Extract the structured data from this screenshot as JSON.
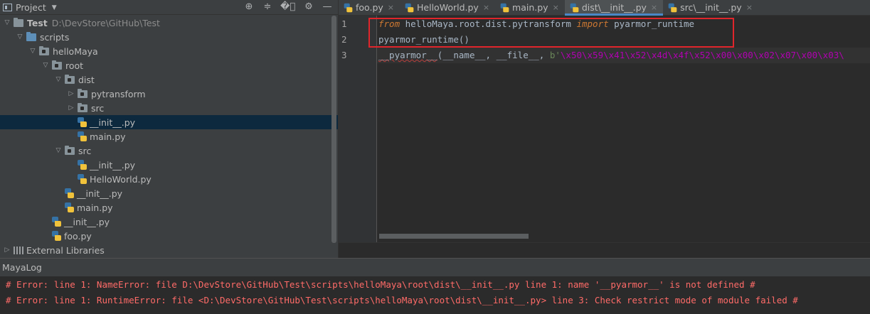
{
  "project_panel": {
    "title": "Project",
    "toolbar_icons": [
      "locate-icon",
      "expand-all-icon",
      "collapse-all-icon",
      "gear-icon",
      "minimize-icon"
    ],
    "tree": [
      {
        "label": "Test",
        "path": "D:\\DevStore\\GitHub\\Test",
        "type": "root-folder",
        "depth": 0,
        "expanded": true
      },
      {
        "label": "scripts",
        "type": "blue-folder",
        "depth": 1,
        "expanded": true
      },
      {
        "label": "helloMaya",
        "type": "package",
        "depth": 2,
        "expanded": true
      },
      {
        "label": "root",
        "type": "package",
        "depth": 3,
        "expanded": true
      },
      {
        "label": "dist",
        "type": "package",
        "depth": 4,
        "expanded": true
      },
      {
        "label": "pytransform",
        "type": "package",
        "depth": 5,
        "expanded": false
      },
      {
        "label": "src",
        "type": "package",
        "depth": 5,
        "expanded": false
      },
      {
        "label": "__init__.py",
        "type": "python-file",
        "depth": 5,
        "selected": true
      },
      {
        "label": "main.py",
        "type": "python-file",
        "depth": 5
      },
      {
        "label": "src",
        "type": "package",
        "depth": 4,
        "expanded": true
      },
      {
        "label": "__init__.py",
        "type": "python-file",
        "depth": 5
      },
      {
        "label": "HelloWorld.py",
        "type": "python-file",
        "depth": 5
      },
      {
        "label": "__init__.py",
        "type": "python-file",
        "depth": 4
      },
      {
        "label": "main.py",
        "type": "python-file",
        "depth": 4
      },
      {
        "label": "__init__.py",
        "type": "python-file",
        "depth": 3
      },
      {
        "label": "foo.py",
        "type": "python-file",
        "depth": 3
      },
      {
        "label": "External Libraries",
        "type": "library",
        "depth": 0,
        "expanded": false
      }
    ]
  },
  "editor": {
    "tabs": [
      {
        "label": "foo.py",
        "active": false
      },
      {
        "label": "HelloWorld.py",
        "active": false
      },
      {
        "label": "main.py",
        "active": false
      },
      {
        "label": "dist\\__init__.py",
        "active": true
      },
      {
        "label": "src\\__init__.py",
        "active": false
      }
    ],
    "close_glyph": "×",
    "line_numbers": [
      "1",
      "2",
      "3"
    ],
    "lines": [
      [
        {
          "text": "from",
          "cls": "kw"
        },
        {
          "text": " helloMaya.root.dist.pytransform ",
          "cls": "plain"
        },
        {
          "text": "import",
          "cls": "kw"
        },
        {
          "text": " pyarmor_runtime",
          "cls": "plain"
        }
      ],
      [
        {
          "text": "pyarmor_runtime",
          "cls": "plain"
        },
        {
          "text": "()",
          "cls": "plain"
        }
      ],
      [
        {
          "text": "__pyarmor__",
          "cls": "plain squig"
        },
        {
          "text": "(__name__, __file__, ",
          "cls": "plain"
        },
        {
          "text": "b'",
          "cls": "str"
        },
        {
          "text": "\\x50\\x59\\x41\\x52\\x4d\\x4f\\x52\\x00\\x00\\x02\\x07\\x00\\x03\\",
          "cls": "dunder"
        }
      ]
    ]
  },
  "log": {
    "title": "MayaLog",
    "lines": [
      "# Error: line 1: NameError: file D:\\DevStore\\GitHub\\Test\\scripts\\helloMaya\\root\\dist\\__init__.py line 1: name '__pyarmor__' is not defined #",
      "# Error: line 1: RuntimeError: file <D:\\DevStore\\GitHub\\Test\\scripts\\helloMaya\\root\\dist\\__init__.py> line 3: Check restrict mode of module failed #"
    ]
  },
  "colors": {
    "background": "#2b2b2b",
    "panel": "#3c3f41",
    "selection": "#0d293e",
    "highlight_box": "#e0252b",
    "error_text": "#ff6b68"
  }
}
